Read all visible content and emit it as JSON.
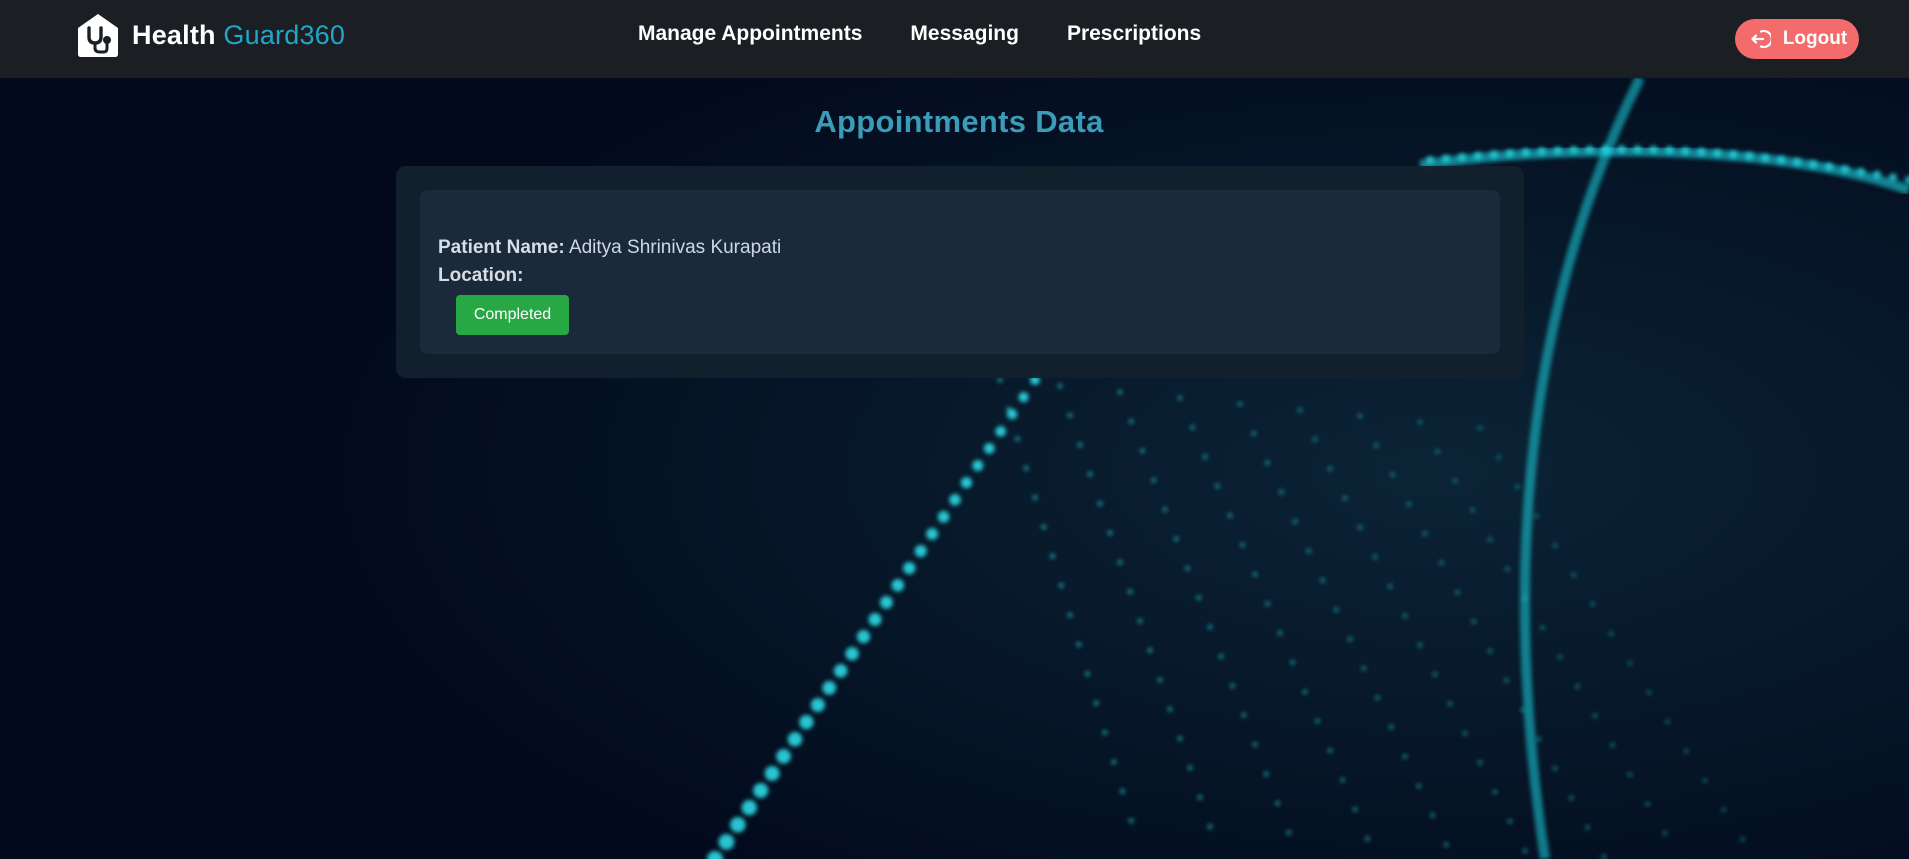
{
  "brand": {
    "name_part1": "Health",
    "name_part2": "Guard360",
    "logo_icon": "stethoscope-house-icon",
    "accent_color": "#1fa6c9"
  },
  "nav": {
    "items": [
      {
        "label": "Manage Appointments"
      },
      {
        "label": "Messaging"
      },
      {
        "label": "Prescriptions"
      }
    ],
    "logout": {
      "label": "Logout",
      "icon": "logout-icon",
      "color": "#f36b6b"
    }
  },
  "page": {
    "title": "Appointments Data"
  },
  "appointments": [
    {
      "patient_label": "Patient Name:",
      "patient_name": "Aditya Shrinivas Kurapati",
      "location_label": "Location:",
      "location": "",
      "status": "Completed",
      "status_color": "#28a745"
    }
  ]
}
